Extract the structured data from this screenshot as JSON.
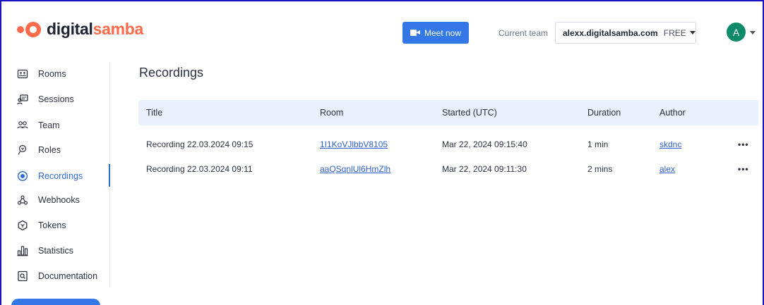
{
  "brand": {
    "name_dark": "digital",
    "name_accent": "samba",
    "accent_color": "#ff6b4a"
  },
  "header": {
    "meet_now_label": "Meet now",
    "current_team_label": "Current team",
    "team_name": "alexx.digitalsamba.com",
    "team_plan": "FREE",
    "avatar_initial": "A",
    "button_color": "#3378e6"
  },
  "sidebar": {
    "items": [
      {
        "label": "Rooms",
        "icon": "rooms-icon"
      },
      {
        "label": "Sessions",
        "icon": "sessions-icon"
      },
      {
        "label": "Team",
        "icon": "team-icon"
      },
      {
        "label": "Roles",
        "icon": "roles-icon"
      },
      {
        "label": "Recordings",
        "icon": "recordings-icon",
        "active": true
      },
      {
        "label": "Webhooks",
        "icon": "webhooks-icon"
      },
      {
        "label": "Tokens",
        "icon": "tokens-icon"
      },
      {
        "label": "Statistics",
        "icon": "statistics-icon"
      },
      {
        "label": "Documentation",
        "icon": "documentation-icon"
      }
    ]
  },
  "main": {
    "title": "Recordings",
    "columns": [
      "Title",
      "Room",
      "Started (UTC)",
      "Duration",
      "Author"
    ],
    "rows": [
      {
        "title": "Recording 22.03.2024 09:15",
        "room": "1I1KoVJlbbV8105",
        "started": "Mar 22, 2024 09:15:40",
        "duration": "1 min",
        "author": "skdnc",
        "more": "•••"
      },
      {
        "title": "Recording 22.03.2024 09:11",
        "room": "aaQSqnlUl6HmZlh",
        "started": "Mar 22, 2024 09:11:30",
        "duration": "2 mins",
        "author": "alex",
        "more": "•••"
      }
    ]
  }
}
